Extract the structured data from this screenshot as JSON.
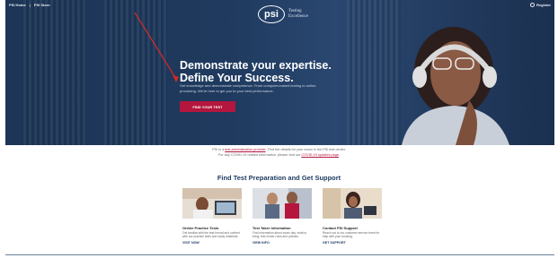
{
  "topbar": {
    "link1": "PSI Home",
    "link2": "PSI Store",
    "login": "Register"
  },
  "logo": {
    "mark": "psi",
    "tagline1": "Testing",
    "tagline2": "Excellence"
  },
  "hero": {
    "headline1": "Demonstrate your expertise.",
    "headline2": "Define Your Success.",
    "subtext": "Get knowledge and demonstrate competence. From computer-based testing to online proctoring. We're here to get you to your best performance.",
    "cta": "FIND YOUR TEST"
  },
  "notice": {
    "line1_pre": "PSI is a ",
    "line1_link": "test administration provider",
    "line1_post": ". Find the details for your exam in the PSI test center.",
    "line2_pre": "For any COVID-19 related information, please visit our ",
    "line2_link": "COVID-19 updates page",
    "line2_post": "."
  },
  "section": {
    "title": "Find Test Preparation and Get Support"
  },
  "cards": [
    {
      "title": "Online Practice Tests",
      "desc": "Get familiar with the test format and content with our practice tests and study materials.",
      "link": "VISIT NOW"
    },
    {
      "title": "Test Taker Information",
      "desc": "Find information about exam day, what to bring, test center rules and policies.",
      "link": "VIEW INFO"
    },
    {
      "title": "Contact PSI Support",
      "desc": "Reach out to our customer service team for help with your booking.",
      "link": "GET SUPPORT"
    }
  ],
  "colors": {
    "hero_bg": "#1f3a5e",
    "accent": "#b4163e",
    "title": "#1f3b63"
  }
}
